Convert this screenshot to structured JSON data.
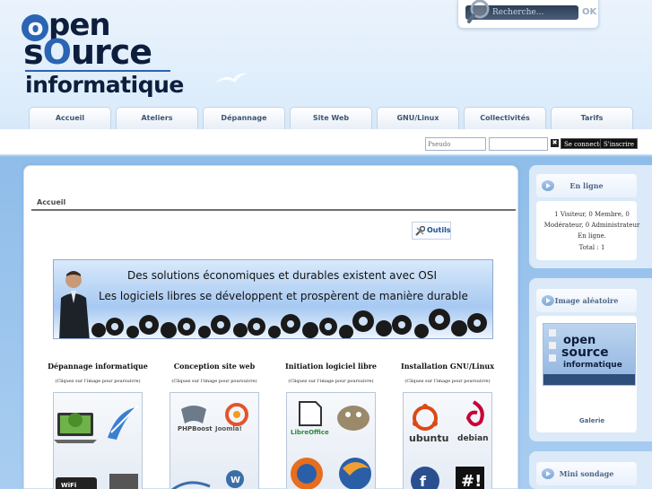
{
  "logo": {
    "line1": "Open",
    "line2": "Source",
    "line3": "informatique"
  },
  "search": {
    "placeholder": "Recherche...",
    "ok_label": "OK"
  },
  "nav": {
    "tabs": [
      {
        "label": "Accueil"
      },
      {
        "label": "Ateliers"
      },
      {
        "label": "Dépannage"
      },
      {
        "label": "Site Web"
      },
      {
        "label": "GNU/Linux"
      },
      {
        "label": "Collectivités"
      },
      {
        "label": "Tarifs"
      }
    ]
  },
  "login": {
    "pseudo_placeholder": "Pseudo",
    "password_value": "",
    "connect_label": "Se connecter",
    "register_label": "S'inscrire",
    "remember_symbol": "✖"
  },
  "main": {
    "breadcrumb": "Accueil",
    "tools_label": "Outils",
    "banner": {
      "line1": "Des solutions économiques et durables existent avec OSI",
      "line2": "Les logiciels libres se développent et prospèrent de manière durable"
    },
    "columns": [
      {
        "title": "Dépannage informatique",
        "note": "(Cliquez sur l'image pour poursuivre)",
        "labels": [
          "WiFi"
        ]
      },
      {
        "title": "Conception site web",
        "note": "(Cliquez sur l'image pour poursuivre)",
        "labels": [
          "PHPBoost",
          "Joomla!"
        ]
      },
      {
        "title": "Initiation logiciel libre",
        "note": "(Cliquez sur l'image pour poursuivre)",
        "labels": [
          "LibreOffice"
        ]
      },
      {
        "title": "Installation GNU/Linux",
        "note": "(Cliquez sur l'image pour poursuivre)",
        "labels": [
          "ubuntu",
          "debian"
        ]
      }
    ]
  },
  "sidebar": {
    "online": {
      "title": "En ligne",
      "text": "1 Visiteur, 0 Membre, 0 Modérateur, 0 Administrateur En ligne.",
      "total": "Total : 1"
    },
    "random_image": {
      "title": "Image aléatoire",
      "gallery_label": "Galerie"
    },
    "poll": {
      "title": "Mini sondage"
    }
  }
}
